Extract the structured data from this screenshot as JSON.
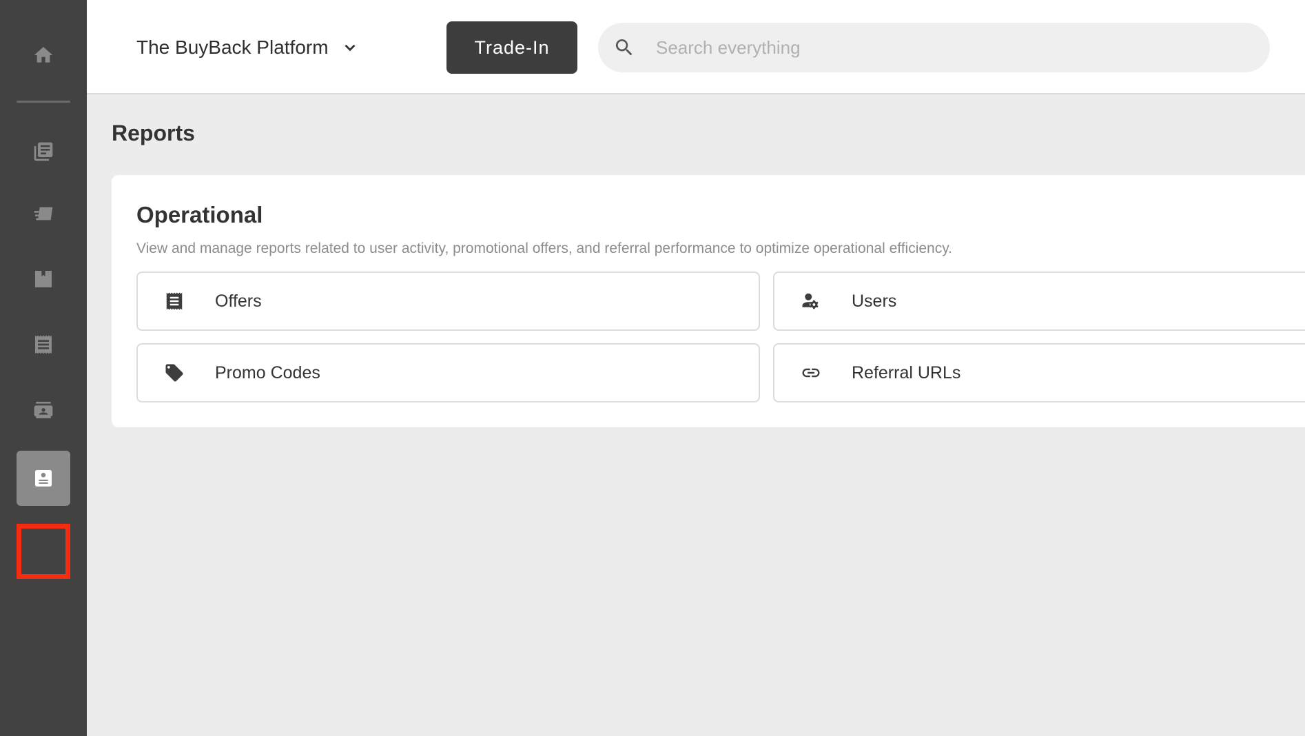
{
  "header": {
    "platform_name": "The BuyBack Platform",
    "trade_in_label": "Trade-In",
    "search_placeholder": "Search everything",
    "search_value": ""
  },
  "sidebar": {
    "items": [
      {
        "icon": "home-icon",
        "active": false
      },
      {
        "icon": "document-list-icon",
        "active": false
      },
      {
        "icon": "shipping-icon",
        "active": false
      },
      {
        "icon": "box-icon",
        "active": false
      },
      {
        "icon": "receipt-icon",
        "active": false
      },
      {
        "icon": "contact-card-icon",
        "active": false
      },
      {
        "icon": "report-icon",
        "active": true
      },
      {
        "icon": "highlighted-empty-item",
        "active": false
      }
    ],
    "highlight_color": "#f42d10"
  },
  "page": {
    "title": "Reports"
  },
  "section": {
    "title": "Operational",
    "description": "View and manage reports related to user activity, promotional offers, and referral performance to optimize operational efficiency.",
    "reports": [
      {
        "label": "Offers",
        "icon": "receipt-list-icon"
      },
      {
        "label": "Users",
        "icon": "user-settings-icon"
      },
      {
        "label": "Promo Codes",
        "icon": "tag-icon"
      },
      {
        "label": "Referral URLs",
        "icon": "link-icon"
      }
    ]
  },
  "colors": {
    "sidebar_bg": "#424242",
    "accent_dark": "#3d3d3d",
    "page_bg": "#ececec"
  }
}
